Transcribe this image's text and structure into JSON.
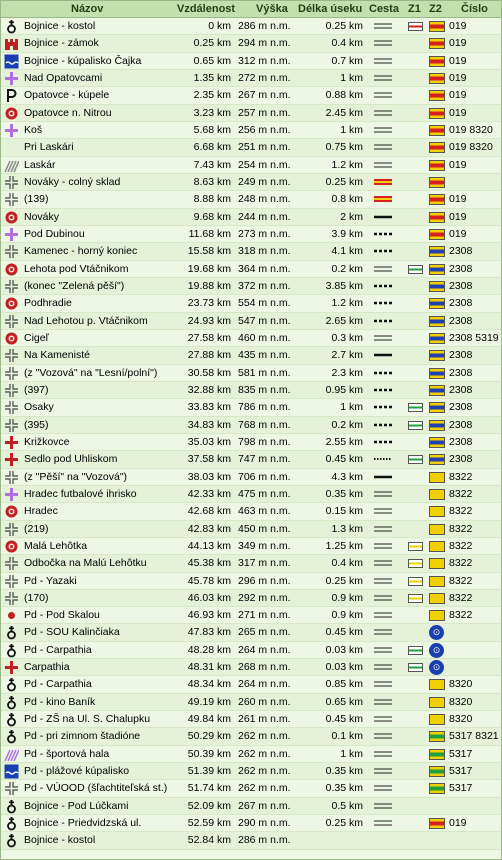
{
  "header": {
    "name": "Názov",
    "distance": "Vzdálenost",
    "altitude": "Výška",
    "segment": "Délka úseku",
    "road": "Cesta",
    "z1": "Z1",
    "z2": "Z2",
    "number": "Číslo"
  },
  "colors": {
    "header_bg": "#c2e0ac",
    "row_bg": "#eef7e4",
    "row_alt_bg": "#e5f2d8",
    "red_mark": "#d62020",
    "yellow_mark": "#f0d000",
    "blue_mark": "#2040b0",
    "green_mark": "#20a040",
    "poi_purple": "#b070e0",
    "poi_red": "#c02020"
  },
  "rows": [
    {
      "name": "Bojnice - kostol",
      "distance": "0 km",
      "altitude": "286 m n.m.",
      "segment": "0.25 km",
      "number": "019",
      "icon": "church-icon",
      "road": "double-road",
      "z1": "red-white",
      "z2": "red-yellow"
    },
    {
      "name": "Bojnice - zámok",
      "distance": "0.25 km",
      "altitude": "294 m n.m.",
      "segment": "0.4 km",
      "number": "019",
      "icon": "castle-icon",
      "road": "double-road",
      "z1": "",
      "z2": "red-yellow"
    },
    {
      "name": "Bojnice - kúpalisko Čajka",
      "distance": "0.65 km",
      "altitude": "312 m n.m.",
      "segment": "0.7 km",
      "number": "019",
      "icon": "pool-icon",
      "road": "double-road",
      "z1": "",
      "z2": "red-yellow"
    },
    {
      "name": "Nad Opatovcami",
      "distance": "1.35 km",
      "altitude": "272 m n.m.",
      "segment": "1 km",
      "number": "019",
      "icon": "crossroad-purple-icon",
      "road": "double-road",
      "z1": "",
      "z2": "red-yellow"
    },
    {
      "name": "Opatovce - kúpele",
      "distance": "2.35 km",
      "altitude": "267 m n.m.",
      "segment": "0.88 km",
      "number": "019",
      "icon": "parking-icon",
      "road": "double-road",
      "z1": "",
      "z2": "red-yellow"
    },
    {
      "name": "Opatovce n. Nitrou",
      "distance": "3.23 km",
      "altitude": "257 m n.m.",
      "segment": "2.45 km",
      "number": "019",
      "icon": "village-icon",
      "road": "double-road",
      "z1": "",
      "z2": "red-yellow"
    },
    {
      "name": "Koš",
      "distance": "5.68 km",
      "altitude": "256 m n.m.",
      "segment": "1 km",
      "number": "019 8320",
      "icon": "crossroad-purple-icon",
      "road": "double-road",
      "z1": "",
      "z2": "red-yellow"
    },
    {
      "name": "Pri Laskári",
      "distance": "6.68 km",
      "altitude": "251 m n.m.",
      "segment": "0.75 km",
      "number": "019 8320",
      "icon": "",
      "road": "double-road",
      "z1": "",
      "z2": "red-yellow"
    },
    {
      "name": "Laskár",
      "distance": "7.43 km",
      "altitude": "254 m n.m.",
      "segment": "1.2 km",
      "number": "019",
      "icon": "hatched-icon",
      "road": "double-road",
      "z1": "",
      "z2": "red-yellow"
    },
    {
      "name": "Nováky - colný sklad",
      "distance": "8.63 km",
      "altitude": "249 m n.m.",
      "segment": "0.25 km",
      "number": "",
      "icon": "crossroad-icon",
      "road": "striped-road",
      "z1": "",
      "z2": "red-yellow"
    },
    {
      "name": "(139)",
      "distance": "8.88 km",
      "altitude": "248 m n.m.",
      "segment": "0.8 km",
      "number": "019",
      "icon": "crossroad-icon",
      "road": "striped-road",
      "z1": "",
      "z2": "red-yellow"
    },
    {
      "name": "Nováky",
      "distance": "9.68 km",
      "altitude": "244 m n.m.",
      "segment": "2 km",
      "number": "019",
      "icon": "village-icon",
      "road": "solid-road",
      "z1": "",
      "z2": "red-yellow"
    },
    {
      "name": "Pod Dubinou",
      "distance": "11.68 km",
      "altitude": "273 m n.m.",
      "segment": "3.9 km",
      "number": "019",
      "icon": "crossroad-purple-icon",
      "road": "dashed-road",
      "z1": "",
      "z2": "red-yellow"
    },
    {
      "name": "Kamenec - horný koniec",
      "distance": "15.58 km",
      "altitude": "318 m n.m.",
      "segment": "4.1 km",
      "number": "2308",
      "icon": "crossroad-icon",
      "road": "dashed-road",
      "z1": "",
      "z2": "blue-yellow"
    },
    {
      "name": "Lehota pod Vtáčnikom",
      "distance": "19.68 km",
      "altitude": "364 m n.m.",
      "segment": "0.2 km",
      "number": "2308",
      "icon": "village-icon",
      "road": "double-road",
      "z1": "green-white",
      "z2": "blue-yellow"
    },
    {
      "name": "(konec \"Zelená pěší\")",
      "distance": "19.88 km",
      "altitude": "372 m n.m.",
      "segment": "3.85 km",
      "number": "2308",
      "icon": "crossroad-icon",
      "road": "dashed-road",
      "z1": "",
      "z2": "blue-yellow"
    },
    {
      "name": "Podhradie",
      "distance": "23.73 km",
      "altitude": "554 m n.m.",
      "segment": "1.2 km",
      "number": "2308",
      "icon": "village-icon",
      "road": "dashed-road",
      "z1": "",
      "z2": "blue-yellow"
    },
    {
      "name": "Nad Lehotou p. Vtáčnikom",
      "distance": "24.93 km",
      "altitude": "547 m n.m.",
      "segment": "2.65 km",
      "number": "2308",
      "icon": "crossroad-icon",
      "road": "dashed-road",
      "z1": "",
      "z2": "blue-yellow"
    },
    {
      "name": "Cigeľ",
      "distance": "27.58 km",
      "altitude": "460 m n.m.",
      "segment": "0.3 km",
      "number": "2308 5319",
      "icon": "village-icon",
      "road": "double-road",
      "z1": "",
      "z2": "blue-yellow"
    },
    {
      "name": "Na Kamenisté",
      "distance": "27.88 km",
      "altitude": "435 m n.m.",
      "segment": "2.7 km",
      "number": "2308",
      "icon": "crossroad-icon",
      "road": "solid-road",
      "z1": "",
      "z2": "blue-yellow"
    },
    {
      "name": "(z \"Vozová\" na \"Lesní/polní\")",
      "distance": "30.58 km",
      "altitude": "581 m n.m.",
      "segment": "2.3 km",
      "number": "2308",
      "icon": "crossroad-icon",
      "road": "dashed-road",
      "z1": "",
      "z2": "blue-yellow"
    },
    {
      "name": "(397)",
      "distance": "32.88 km",
      "altitude": "835 m n.m.",
      "segment": "0.95 km",
      "number": "2308",
      "icon": "crossroad-icon",
      "road": "dashed-road",
      "z1": "",
      "z2": "blue-yellow"
    },
    {
      "name": "Osaky",
      "distance": "33.83 km",
      "altitude": "786 m n.m.",
      "segment": "1 km",
      "number": "2308",
      "icon": "crossroad-icon",
      "road": "dashed-road",
      "z1": "green-white",
      "z2": "blue-yellow"
    },
    {
      "name": "(395)",
      "distance": "34.83 km",
      "altitude": "768 m n.m.",
      "segment": "0.2 km",
      "number": "2308",
      "icon": "crossroad-icon",
      "road": "dashed-road",
      "z1": "green-white",
      "z2": "blue-yellow"
    },
    {
      "name": "Križkovce",
      "distance": "35.03 km",
      "altitude": "798 m n.m.",
      "segment": "2.55 km",
      "number": "2308",
      "icon": "crossroad-red-icon",
      "road": "dashed-road",
      "z1": "",
      "z2": "blue-yellow"
    },
    {
      "name": "Sedlo pod Uhliskom",
      "distance": "37.58 km",
      "altitude": "747 m n.m.",
      "segment": "0.45 km",
      "number": "2308",
      "icon": "crossroad-red-icon",
      "road": "dotted-road",
      "z1": "green-white",
      "z2": "blue-yellow"
    },
    {
      "name": "(z \"Pěší\" na \"Vozová\")",
      "distance": "38.03 km",
      "altitude": "706 m n.m.",
      "segment": "4.3 km",
      "number": "8322",
      "icon": "crossroad-icon",
      "road": "solid-road",
      "z1": "",
      "z2": "yellow"
    },
    {
      "name": "Hradec futbalové ihrisko",
      "distance": "42.33 km",
      "altitude": "475 m n.m.",
      "segment": "0.35 km",
      "number": "8322",
      "icon": "crossroad-purple-icon",
      "road": "double-road",
      "z1": "",
      "z2": "yellow"
    },
    {
      "name": "Hradec",
      "distance": "42.68 km",
      "altitude": "463 m n.m.",
      "segment": "0.15 km",
      "number": "8322",
      "icon": "village-icon",
      "road": "double-road",
      "z1": "",
      "z2": "yellow"
    },
    {
      "name": "(219)",
      "distance": "42.83 km",
      "altitude": "450 m n.m.",
      "segment": "1.3 km",
      "number": "8322",
      "icon": "crossroad-icon",
      "road": "double-road",
      "z1": "",
      "z2": "yellow"
    },
    {
      "name": "Malá Lehôtka",
      "distance": "44.13 km",
      "altitude": "349 m n.m.",
      "segment": "1.25 km",
      "number": "8322",
      "icon": "village-icon",
      "road": "double-road",
      "z1": "yellow-white",
      "z2": "yellow"
    },
    {
      "name": "Odbočka na Malú Lehôtku",
      "distance": "45.38 km",
      "altitude": "317 m n.m.",
      "segment": "0.4 km",
      "number": "8322",
      "icon": "crossroad-icon",
      "road": "double-road",
      "z1": "yellow-white",
      "z2": "yellow"
    },
    {
      "name": "Pd - Yazaki",
      "distance": "45.78 km",
      "altitude": "296 m n.m.",
      "segment": "0.25 km",
      "number": "8322",
      "icon": "crossroad-icon",
      "road": "double-road",
      "z1": "yellow-white",
      "z2": "yellow"
    },
    {
      "name": "(170)",
      "distance": "46.03 km",
      "altitude": "292 m n.m.",
      "segment": "0.9 km",
      "number": "8322",
      "icon": "crossroad-icon",
      "road": "double-road",
      "z1": "yellow-white",
      "z2": "yellow"
    },
    {
      "name": "Pd - Pod Skalou",
      "distance": "46.93 km",
      "altitude": "271 m n.m.",
      "segment": "0.9 km",
      "number": "8322",
      "icon": "dot-red-icon",
      "road": "double-road",
      "z1": "",
      "z2": "yellow"
    },
    {
      "name": "Pd - SOU Kalinčiaka",
      "distance": "47.83 km",
      "altitude": "265 m n.m.",
      "segment": "0.45 km",
      "number": "",
      "icon": "church-icon",
      "road": "double-road",
      "z1": "",
      "z2": "bike"
    },
    {
      "name": "Pd - Carpathia",
      "distance": "48.28 km",
      "altitude": "264 m n.m.",
      "segment": "0.03 km",
      "number": "",
      "icon": "church-icon",
      "road": "double-road",
      "z1": "green-white",
      "z2": "bike"
    },
    {
      "name": "Carpathia",
      "distance": "48.31 km",
      "altitude": "268 m n.m.",
      "segment": "0.03 km",
      "number": "",
      "icon": "crossroad-red-icon",
      "road": "double-road",
      "z1": "green-white",
      "z2": "bike"
    },
    {
      "name": "Pd - Carpathia",
      "distance": "48.34 km",
      "altitude": "264 m n.m.",
      "segment": "0.85 km",
      "number": "8320",
      "icon": "church-icon",
      "road": "double-road",
      "z1": "",
      "z2": "yellow"
    },
    {
      "name": "Pd - kino Baník",
      "distance": "49.19 km",
      "altitude": "260 m n.m.",
      "segment": "0.65 km",
      "number": "8320",
      "icon": "church-icon",
      "road": "double-road",
      "z1": "",
      "z2": "yellow"
    },
    {
      "name": "Pd - ZŠ na Ul. S. Chalupku",
      "distance": "49.84 km",
      "altitude": "261 m n.m.",
      "segment": "0.45 km",
      "number": "8320",
      "icon": "church-icon",
      "road": "double-road",
      "z1": "",
      "z2": "yellow"
    },
    {
      "name": "Pd - pri zimnom štadióne",
      "distance": "50.29 km",
      "altitude": "262 m n.m.",
      "segment": "0.1 km",
      "number": "5317 8321",
      "icon": "church-icon",
      "road": "double-road",
      "z1": "",
      "z2": "green-yellow"
    },
    {
      "name": "Pd - športová hala",
      "distance": "50.39 km",
      "altitude": "262 m n.m.",
      "segment": "1 km",
      "number": "5317",
      "icon": "hatched-purple-icon",
      "road": "double-road",
      "z1": "",
      "z2": "green-yellow"
    },
    {
      "name": "Pd - plážové kúpalisko",
      "distance": "51.39 km",
      "altitude": "262 m n.m.",
      "segment": "0.35 km",
      "number": "5317",
      "icon": "pool-icon",
      "road": "double-road",
      "z1": "",
      "z2": "green-yellow"
    },
    {
      "name": "Pd - VÚOOD (šľachtiteľská st.)",
      "distance": "51.74 km",
      "altitude": "262 m n.m.",
      "segment": "0.35 km",
      "number": "5317",
      "icon": "crossroad-icon",
      "road": "double-road",
      "z1": "",
      "z2": "green-yellow"
    },
    {
      "name": "Bojnice - Pod Lúčkami",
      "distance": "52.09 km",
      "altitude": "267 m n.m.",
      "segment": "0.5 km",
      "number": "",
      "icon": "church-icon",
      "road": "double-road",
      "z1": "",
      "z2": ""
    },
    {
      "name": "Bojnice - Priedvidzská ul.",
      "distance": "52.59 km",
      "altitude": "290 m n.m.",
      "segment": "0.25 km",
      "number": "019",
      "icon": "church-icon",
      "road": "double-road",
      "z1": "",
      "z2": "red-yellow"
    },
    {
      "name": "Bojnice - kostol",
      "distance": "52.84 km",
      "altitude": "286 m n.m.",
      "segment": "",
      "number": "",
      "icon": "church-icon",
      "road": "",
      "z1": "",
      "z2": ""
    }
  ]
}
